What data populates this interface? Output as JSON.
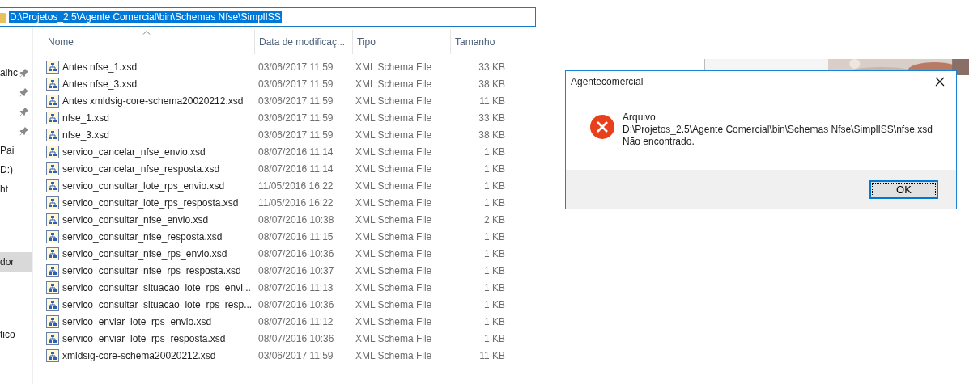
{
  "address_bar": {
    "path": "D:\\Projetos_2.5\\Agente Comercial\\bin\\Schemas Nfse\\SimplISS",
    "selected": true
  },
  "sidebar": {
    "groups": [
      [
        {
          "label": "alhc",
          "pinned": true,
          "selected": false
        },
        {
          "pinned": true,
          "selected": false
        },
        {
          "pinned": true,
          "selected": false
        },
        {
          "pinned": true,
          "selected": false
        },
        {
          "label": "Pai",
          "pinned": false,
          "selected": false
        },
        {
          "label": "D:)",
          "pinned": false,
          "selected": false
        },
        {
          "label": "ht",
          "pinned": false,
          "selected": false
        }
      ],
      [
        {
          "label": "dor",
          "pinned": false,
          "selected": true
        }
      ],
      [
        {
          "label": "tico",
          "pinned": false,
          "selected": false
        }
      ]
    ]
  },
  "table": {
    "columns": [
      {
        "label": "Nome",
        "sorted": true
      },
      {
        "label": "Data de modificaç...",
        "sorted": false
      },
      {
        "label": "Tipo",
        "sorted": false
      },
      {
        "label": "Tamanho",
        "sorted": false
      }
    ],
    "rows": [
      {
        "name": "Antes nfse_1.xsd",
        "date": "03/06/2017 11:59",
        "type": "XML Schema File",
        "size": "33 KB"
      },
      {
        "name": "Antes nfse_3.xsd",
        "date": "03/06/2017 11:59",
        "type": "XML Schema File",
        "size": "38 KB"
      },
      {
        "name": "Antes xmldsig-core-schema20020212.xsd",
        "date": "03/06/2017 11:59",
        "type": "XML Schema File",
        "size": "11 KB"
      },
      {
        "name": "nfse_1.xsd",
        "date": "03/06/2017 11:59",
        "type": "XML Schema File",
        "size": "33 KB"
      },
      {
        "name": "nfse_3.xsd",
        "date": "03/06/2017 11:59",
        "type": "XML Schema File",
        "size": "38 KB"
      },
      {
        "name": "servico_cancelar_nfse_envio.xsd",
        "date": "08/07/2016 11:14",
        "type": "XML Schema File",
        "size": "1 KB"
      },
      {
        "name": "servico_cancelar_nfse_resposta.xsd",
        "date": "08/07/2016 11:14",
        "type": "XML Schema File",
        "size": "1 KB"
      },
      {
        "name": "servico_consultar_lote_rps_envio.xsd",
        "date": "11/05/2016 16:22",
        "type": "XML Schema File",
        "size": "1 KB"
      },
      {
        "name": "servico_consultar_lote_rps_resposta.xsd",
        "date": "11/05/2016 16:22",
        "type": "XML Schema File",
        "size": "1 KB"
      },
      {
        "name": "servico_consultar_nfse_envio.xsd",
        "date": "08/07/2016 10:38",
        "type": "XML Schema File",
        "size": "2 KB"
      },
      {
        "name": "servico_consultar_nfse_resposta.xsd",
        "date": "08/07/2016 11:15",
        "type": "XML Schema File",
        "size": "1 KB"
      },
      {
        "name": "servico_consultar_nfse_rps_envio.xsd",
        "date": "08/07/2016 10:36",
        "type": "XML Schema File",
        "size": "1 KB"
      },
      {
        "name": "servico_consultar_nfse_rps_resposta.xsd",
        "date": "08/07/2016 10:37",
        "type": "XML Schema File",
        "size": "1 KB"
      },
      {
        "name": "servico_consultar_situacao_lote_rps_envi...",
        "date": "08/07/2016 11:13",
        "type": "XML Schema File",
        "size": "1 KB"
      },
      {
        "name": "servico_consultar_situacao_lote_rps_resp...",
        "date": "08/07/2016 10:36",
        "type": "XML Schema File",
        "size": "1 KB"
      },
      {
        "name": "servico_enviar_lote_rps_envio.xsd",
        "date": "08/07/2016 11:12",
        "type": "XML Schema File",
        "size": "1 KB"
      },
      {
        "name": "servico_enviar_lote_rps_resposta.xsd",
        "date": "08/07/2016 10:36",
        "type": "XML Schema File",
        "size": "1 KB"
      },
      {
        "name": "xmldsig-core-schema20020212.xsd",
        "date": "03/06/2017 11:59",
        "type": "XML Schema File",
        "size": "11 KB"
      }
    ]
  },
  "dialog": {
    "title": "Agentecomercial",
    "lines": [
      "Arquivo",
      "D:\\Projetos_2.5\\Agente Comercial\\bin\\Schemas Nfse\\SimplISS\\nfse.xsd",
      "Não encontrado."
    ],
    "buttons": [
      {
        "label": "OK",
        "selected": true
      }
    ]
  }
}
